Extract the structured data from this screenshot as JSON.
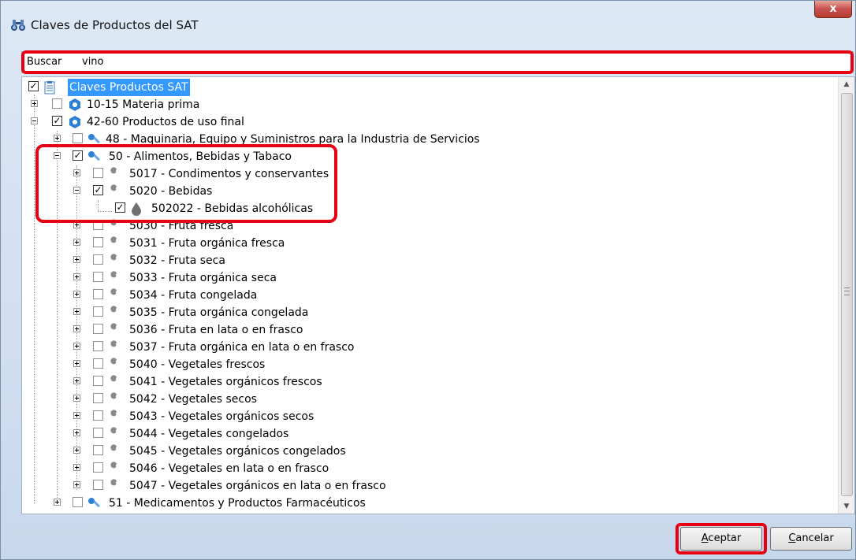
{
  "window": {
    "title": "Claves de Productos del SAT",
    "close_label": "x"
  },
  "search": {
    "label": "Buscar",
    "value": "vino"
  },
  "tree": {
    "root": "Claves Productos SAT",
    "n1": "10-15 Materia prima",
    "n2": "42-60 Productos de uso final",
    "n3": "48 - Maquinaria, Equipo y Suministros para la Industria de Servicios",
    "n4": "50 - Alimentos, Bebidas y Tabaco",
    "n5": "5017 - Condimentos y conservantes",
    "n6": "5020 - Bebidas",
    "n7": "502022 - Bebidas alcohólicas",
    "n8": "5030 - Fruta fresca",
    "n9": "5031 - Fruta orgánica fresca",
    "n10": "5032 - Fruta seca",
    "n11": "5033 - Fruta orgánica seca",
    "n12": "5034 - Fruta congelada",
    "n13": "5035 - Fruta orgánica congelada",
    "n14": "5036 - Fruta en lata o en frasco",
    "n15": "5037 - Fruta orgánica en lata o en frasco",
    "n16": "5040 - Vegetales frescos",
    "n17": "5041 - Vegetales orgánicos frescos",
    "n18": "5042 - Vegetales secos",
    "n19": "5043 - Vegetales orgánicos secos",
    "n20": "5044 - Vegetales congelados",
    "n21": "5045 - Vegetales orgánicos congelados",
    "n22": "5046 - Vegetales en lata o en frasco",
    "n23": "5047 - Vegetales orgánicos en lata o en frasco",
    "n24": "51 - Medicamentos y Productos Farmacéuticos"
  },
  "buttons": {
    "accept_u": "A",
    "accept_rest": "ceptar",
    "cancel_u": "C",
    "cancel_rest": "ancelar"
  },
  "colors": {
    "highlight": "#e60012",
    "selection": "#3399ff"
  }
}
